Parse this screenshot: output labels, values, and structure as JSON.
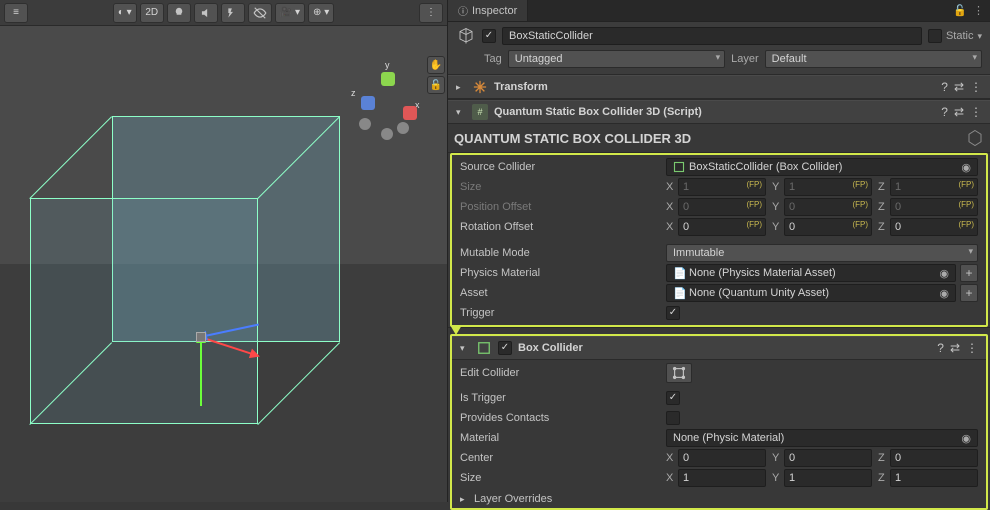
{
  "sceneToolbar": {
    "btn2d": "2D"
  },
  "axisLabels": {
    "x": "x",
    "y": "y",
    "z": "z"
  },
  "inspector": {
    "tab": "Inspector",
    "lockIcon": "🔒",
    "moreIcon": "⋮",
    "objectEnabled": true,
    "objectName": "BoxStaticCollider",
    "staticLabel": "Static",
    "tagLabel": "Tag",
    "tagValue": "Untagged",
    "layerLabel": "Layer",
    "layerValue": "Default"
  },
  "transformComp": {
    "title": "Transform"
  },
  "quantumComp": {
    "headerTitle": "Quantum Static Box Collider 3D (Script)",
    "sectionTitle": "QUANTUM STATIC BOX COLLIDER 3D",
    "sourceColliderLabel": "Source Collider",
    "sourceColliderValue": "BoxStaticCollider (Box Collider)",
    "sizeLabel": "Size",
    "size": {
      "x": "1",
      "y": "1",
      "z": "1"
    },
    "positionOffsetLabel": "Position Offset",
    "positionOffset": {
      "x": "0",
      "y": "0",
      "z": "0"
    },
    "rotationOffsetLabel": "Rotation Offset",
    "rotationOffset": {
      "x": "0",
      "y": "0",
      "z": "0"
    },
    "mutableModeLabel": "Mutable Mode",
    "mutableModeValue": "Immutable",
    "physicsMaterialLabel": "Physics Material",
    "physicsMaterialValue": "None (Physics Material Asset)",
    "assetLabel": "Asset",
    "assetValue": "None (Quantum Unity Asset)",
    "triggerLabel": "Trigger",
    "triggerChecked": true
  },
  "boxCollider": {
    "title": "Box Collider",
    "enabled": true,
    "editColliderLabel": "Edit Collider",
    "isTriggerLabel": "Is Trigger",
    "isTriggerChecked": true,
    "providesContactsLabel": "Provides Contacts",
    "providesContactsChecked": false,
    "materialLabel": "Material",
    "materialValue": "None (Physic Material)",
    "centerLabel": "Center",
    "center": {
      "x": "0",
      "y": "0",
      "z": "0"
    },
    "sizeLabel": "Size",
    "size": {
      "x": "1",
      "y": "1",
      "z": "1"
    },
    "layerOverridesLabel": "Layer Overrides"
  },
  "fpTag": "(FP)",
  "axisX": "X",
  "axisY": "Y",
  "axisZ": "Z"
}
